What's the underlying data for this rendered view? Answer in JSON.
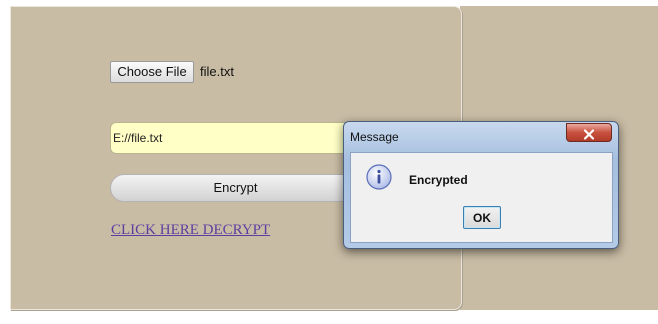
{
  "form": {
    "choose_file_label": "Choose File",
    "selected_file": "file.txt",
    "path_value": "E://file.txt",
    "encrypt_label": "Encrypt",
    "decrypt_link": "CLICK HERE DECRYPT"
  },
  "dialog": {
    "title": "Message",
    "close_label": "x",
    "icon": "info-icon",
    "message": "Encrypted",
    "ok_label": "OK"
  },
  "colors": {
    "panel_background": "#c9bca5",
    "input_background": "#ffffc6",
    "link": "#5b3fa0",
    "dialog_frame": "#a6bfdf",
    "close_button": "#c8513f"
  }
}
